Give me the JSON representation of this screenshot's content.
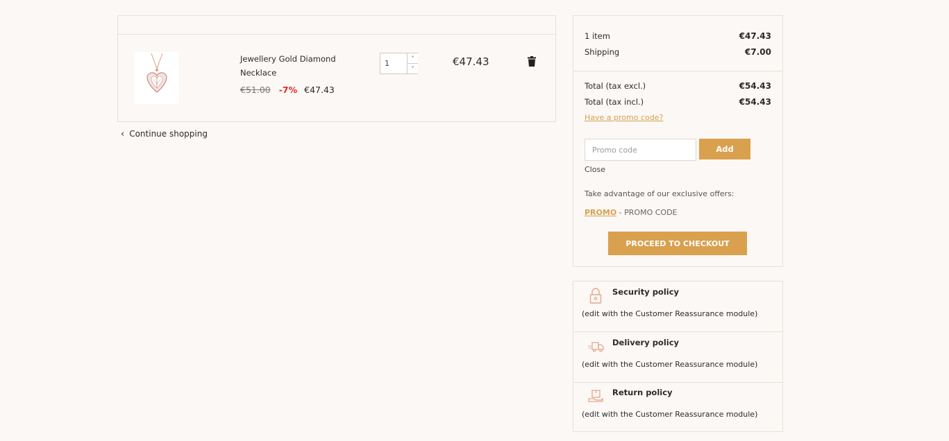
{
  "cart": {
    "product": {
      "name": "Jewellery Gold Diamond Necklace",
      "old_price": "€51.00",
      "discount": "-7%",
      "price": "€47.43",
      "quantity": "1",
      "line_total": "€47.43"
    },
    "continue_label": "Continue shopping"
  },
  "summary": {
    "items_label": "1 item",
    "items_amount": "€47.43",
    "shipping_label": "Shipping",
    "shipping_amount": "€7.00",
    "total_excl_label": "Total (tax excl.)",
    "total_excl_amount": "€54.43",
    "total_incl_label": "Total (tax incl.)",
    "total_incl_amount": "€54.43",
    "promo_link": "Have a promo code?",
    "promo_placeholder": "Promo code",
    "add_label": "Add",
    "close_label": "Close",
    "offers_text": "Take advantage of our exclusive offers:",
    "promo_code": "PROMO",
    "promo_desc": " - PROMO CODE",
    "checkout_label": "PROCEED TO CHECKOUT"
  },
  "reassurance": [
    {
      "title": "Security policy",
      "desc": "(edit with the Customer Reassurance module)",
      "icon": "lock-icon"
    },
    {
      "title": "Delivery policy",
      "desc": "(edit with the Customer Reassurance module)",
      "icon": "truck-icon"
    },
    {
      "title": "Return policy",
      "desc": "(edit with the Customer Reassurance module)",
      "icon": "return-box-icon"
    }
  ],
  "colors": {
    "accent": "#d9a04d",
    "discount": "#e02b27",
    "background": "#fbf8f5"
  }
}
